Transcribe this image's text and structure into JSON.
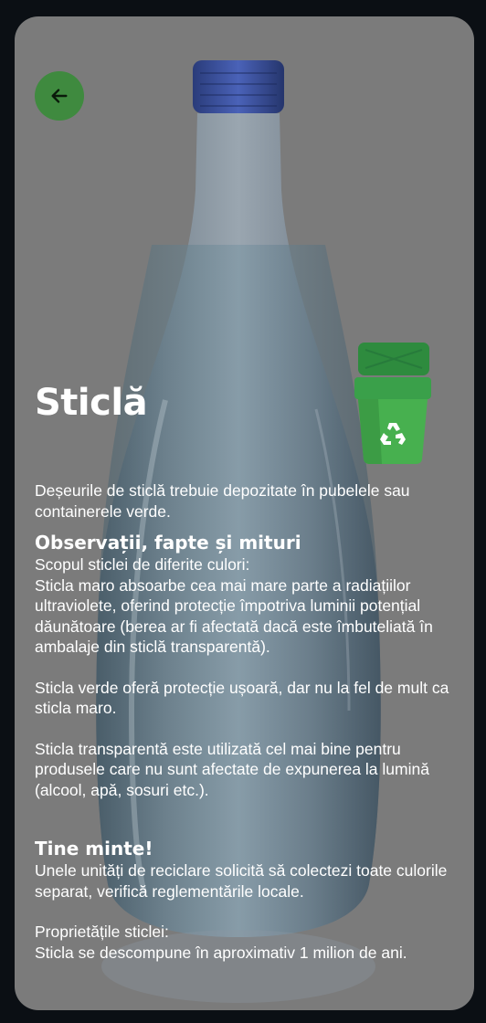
{
  "screen": {
    "title": "Sticlă",
    "intro": "Deșeurile de sticlă  trebuie depozitate în pubelele sau containerele verde.",
    "sections": [
      {
        "heading": "Observații, fapte și  mituri",
        "paragraphs": [
          "Scopul sticlei de diferite culori:\nSticla maro absoarbe cea mai mare parte a radiațiilor ultraviolete, oferind protecție împotriva luminii potențial dăunătoare (berea ar fi afectată dacă este îmbuteliată în ambalaje din sticlă transparentă).",
          "Sticla verde oferă protecție ușoară, dar nu la fel de mult ca sticla maro.",
          "Sticla transparentă este utilizată cel mai bine pentru produsele care nu sunt afectate de expunerea la lumină (alcool, apă, sosuri etc.)."
        ]
      },
      {
        "heading": "Tine minte!",
        "paragraphs": [
          "Unele unități de reciclare solicită să colectezi toate culorile separat, verifică reglementările locale.",
          "Proprietățile sticlei:\nSticla se descompune în aproximativ 1 milion de ani."
        ]
      }
    ]
  },
  "icons": {
    "back": "arrow-left-icon",
    "bin": "recycle-bin-icon"
  },
  "colors": {
    "overlay": "#7b7b7b",
    "back_button": "#3f8a3f",
    "bin_green": "#3aa04a",
    "text": "#ffffff"
  }
}
